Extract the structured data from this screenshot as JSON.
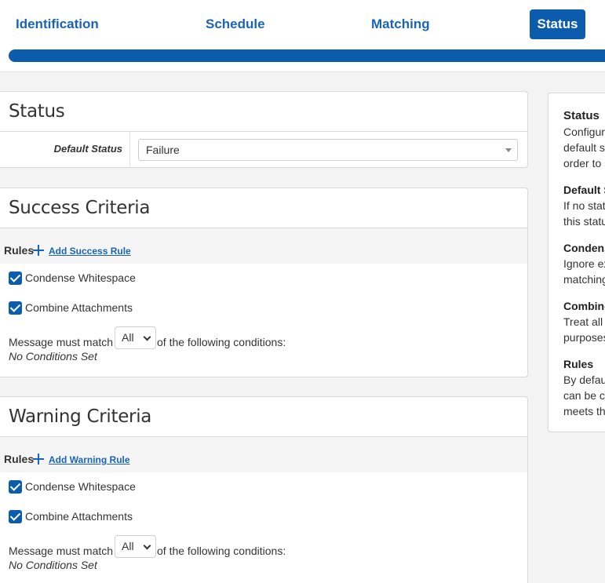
{
  "wizard": {
    "steps": [
      {
        "label": "Identification"
      },
      {
        "label": "Schedule"
      },
      {
        "label": "Matching"
      },
      {
        "label": "Status"
      }
    ]
  },
  "status_card": {
    "title": "Status",
    "default_status_label": "Default Status",
    "default_status_value": "Failure"
  },
  "success_card": {
    "title": "Success Criteria",
    "rules_label": "Rules",
    "add_rule_label": "Add Success Rule",
    "condense_whitespace": {
      "label": "Condense Whitespace",
      "checked": true
    },
    "combine_attachments": {
      "label": "Combine Attachments",
      "checked": true
    },
    "match_prefix": "Message must match",
    "match_value": "All",
    "match_suffix": "of the following conditions:",
    "no_conditions": "No Conditions Set"
  },
  "warning_card": {
    "title": "Warning Criteria",
    "rules_label": "Rules",
    "add_rule_label": "Add Warning Rule",
    "condense_whitespace": {
      "label": "Condense Whitespace",
      "checked": true
    },
    "combine_attachments": {
      "label": "Combine Attachments",
      "checked": true
    },
    "match_prefix": "Message must match",
    "match_value": "All",
    "match_suffix": "of the following conditions:",
    "no_conditions": "No Conditions Set"
  },
  "help": {
    "sections": [
      {
        "title": "Status",
        "lines": [
          "Configur",
          "default s",
          "order to s"
        ]
      },
      {
        "title": "Default S",
        "lines": [
          "If no stat",
          "this statu"
        ]
      },
      {
        "title": "Condens",
        "lines": [
          "Ignore ex",
          "matching"
        ]
      },
      {
        "title": "Combine",
        "lines": [
          "Treat all",
          "purposes"
        ]
      },
      {
        "title": "Rules",
        "lines": [
          "By defau",
          "can be c",
          "meets th"
        ]
      }
    ]
  },
  "colors": {
    "accent": "#0b5cad",
    "link": "#1a64b8"
  }
}
